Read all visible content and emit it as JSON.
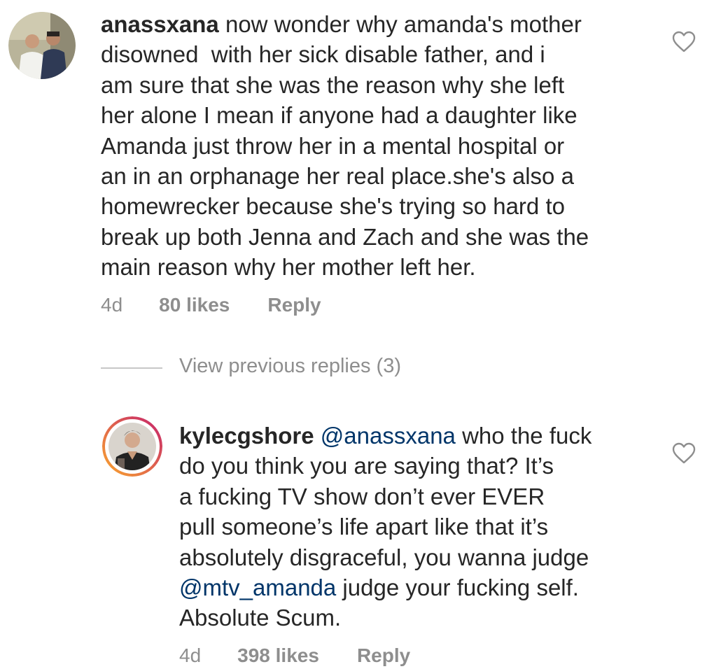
{
  "comments": [
    {
      "username": "anassxana",
      "text_lines": [
        " now wonder why amanda's mother",
        "disowned  with her sick disable father, and i",
        "am sure that she was the reason why she left",
        "her alone I mean if anyone had a daughter like",
        "Amanda just throw her in a mental hospital or",
        "an in an orphanage her real place.she's also a",
        "homewrecker because she's trying so hard to",
        "break up both Jenna and Zach and she was the",
        "main reason why her mother left her."
      ],
      "time": "4d",
      "likes": "80 likes",
      "reply_label": "Reply",
      "like_icon": "heart-outline-icon"
    },
    {
      "username": "kylecgshore",
      "mention_1": "@anassxana",
      "line1_rest": " who the fuck",
      "text_lines": [
        "do you think you are saying that? It’s",
        "a fucking TV show don’t ever EVER",
        "pull someone’s life apart like that it’s",
        "absolutely disgraceful, you wanna judge"
      ],
      "mention_2": "@mtv_amanda",
      "line6_rest": " judge your fucking self.",
      "last_line": "Absolute Scum.",
      "time": "4d",
      "likes": "398 likes",
      "reply_label": "Reply",
      "like_icon": "heart-outline-icon"
    }
  ],
  "view_previous_replies": "View previous replies (3)",
  "colors": {
    "text": "#262626",
    "meta": "#8e8e8e",
    "mention": "#003569",
    "divider": "#c7c7c7",
    "story_ring_start": "#f9a52e",
    "story_ring_end": "#c6236c"
  }
}
